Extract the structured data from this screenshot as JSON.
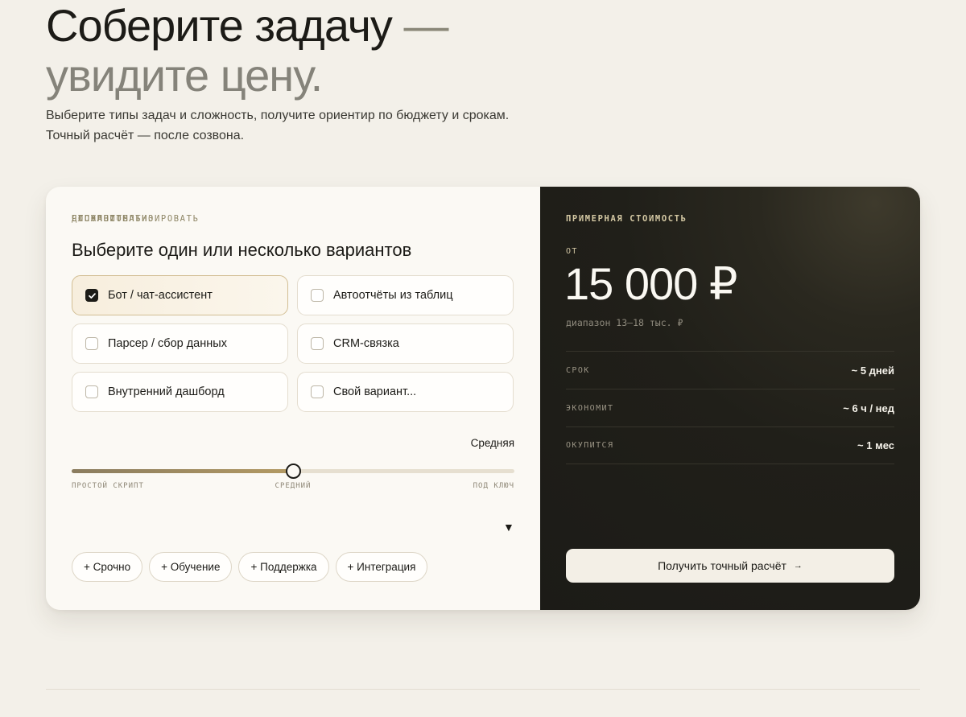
{
  "hero": {
    "title_line1": "Соберите задачу",
    "title_dash": "—",
    "title_line2": "увидите цену.",
    "lead": "Выберите типы задач и сложность, получите ориентир по бюджету и срокам. Точный расчёт — после созвона."
  },
  "builder": {
    "eyebrow": "ЧТО АВТОМАТИЗИРОВАТЬ",
    "question": "Выберите один или несколько вариантов",
    "options": [
      {
        "label": "Бот / чат-ассистент",
        "checked": true
      },
      {
        "label": "Автоотчёты из таблиц",
        "checked": false
      },
      {
        "label": "Парсер / сбор данных",
        "checked": false
      },
      {
        "label": "CRM-связка",
        "checked": false
      },
      {
        "label": "Внутренний дашборд",
        "checked": false
      },
      {
        "label": "Свой вариант...",
        "checked": false
      }
    ],
    "difficulty": {
      "label": "СЛОЖНОСТЬ",
      "value": "Средняя",
      "level": 0.5,
      "ticks": {
        "min": "ПРОСТОЙ СКРИПТ",
        "mid": "СРЕДНИЙ",
        "max": "ПОД КЛЮЧ"
      }
    },
    "extras": {
      "label": "ДОПОЛНИТЕЛЬНО",
      "toggle_icon": "▼",
      "chips": [
        "+ Срочно",
        "+ Обучение",
        "+ Поддержка",
        "+ Интеграция"
      ]
    }
  },
  "estimate": {
    "eyebrow": "ПРИМЕРНАЯ СТОИМОСТЬ",
    "from_label": "ОТ",
    "price": "15 000 ₽",
    "range": "диапазон 13–18 тыс. ₽",
    "stats": [
      {
        "key": "СРОК",
        "value": "~ 5 дней"
      },
      {
        "key": "ЭКОНОМИТ",
        "value": "~ 6 ч / нед"
      },
      {
        "key": "ОКУПИТСЯ",
        "value": "~ 1 мес"
      }
    ],
    "cta_label": "Получить точный расчёт",
    "cta_arrow": "→"
  }
}
